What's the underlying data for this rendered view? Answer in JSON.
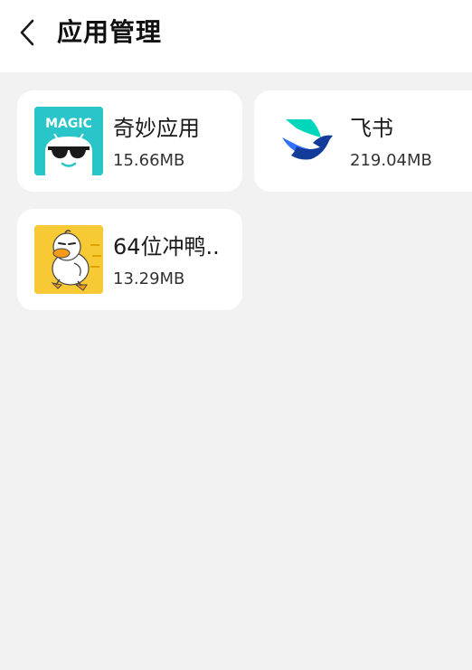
{
  "header": {
    "title": "应用管理",
    "back_icon": "chevron-left-icon"
  },
  "apps": [
    {
      "name": "奇妙应用",
      "size": "15.66MB",
      "icon": "magic-app-icon",
      "icon_text": "MAGIC",
      "icon_color": "#29c5c8"
    },
    {
      "name": "飞书",
      "size": "219.04MB",
      "icon": "feishu-icon",
      "icon_color": "#3370ff"
    },
    {
      "name": "64位冲鸭..",
      "size": "13.29MB",
      "icon": "duck-icon",
      "icon_color": "#f7c934"
    }
  ],
  "colors": {
    "background": "#f2f2f2",
    "card": "#ffffff",
    "text_primary": "#1a1a1a"
  }
}
